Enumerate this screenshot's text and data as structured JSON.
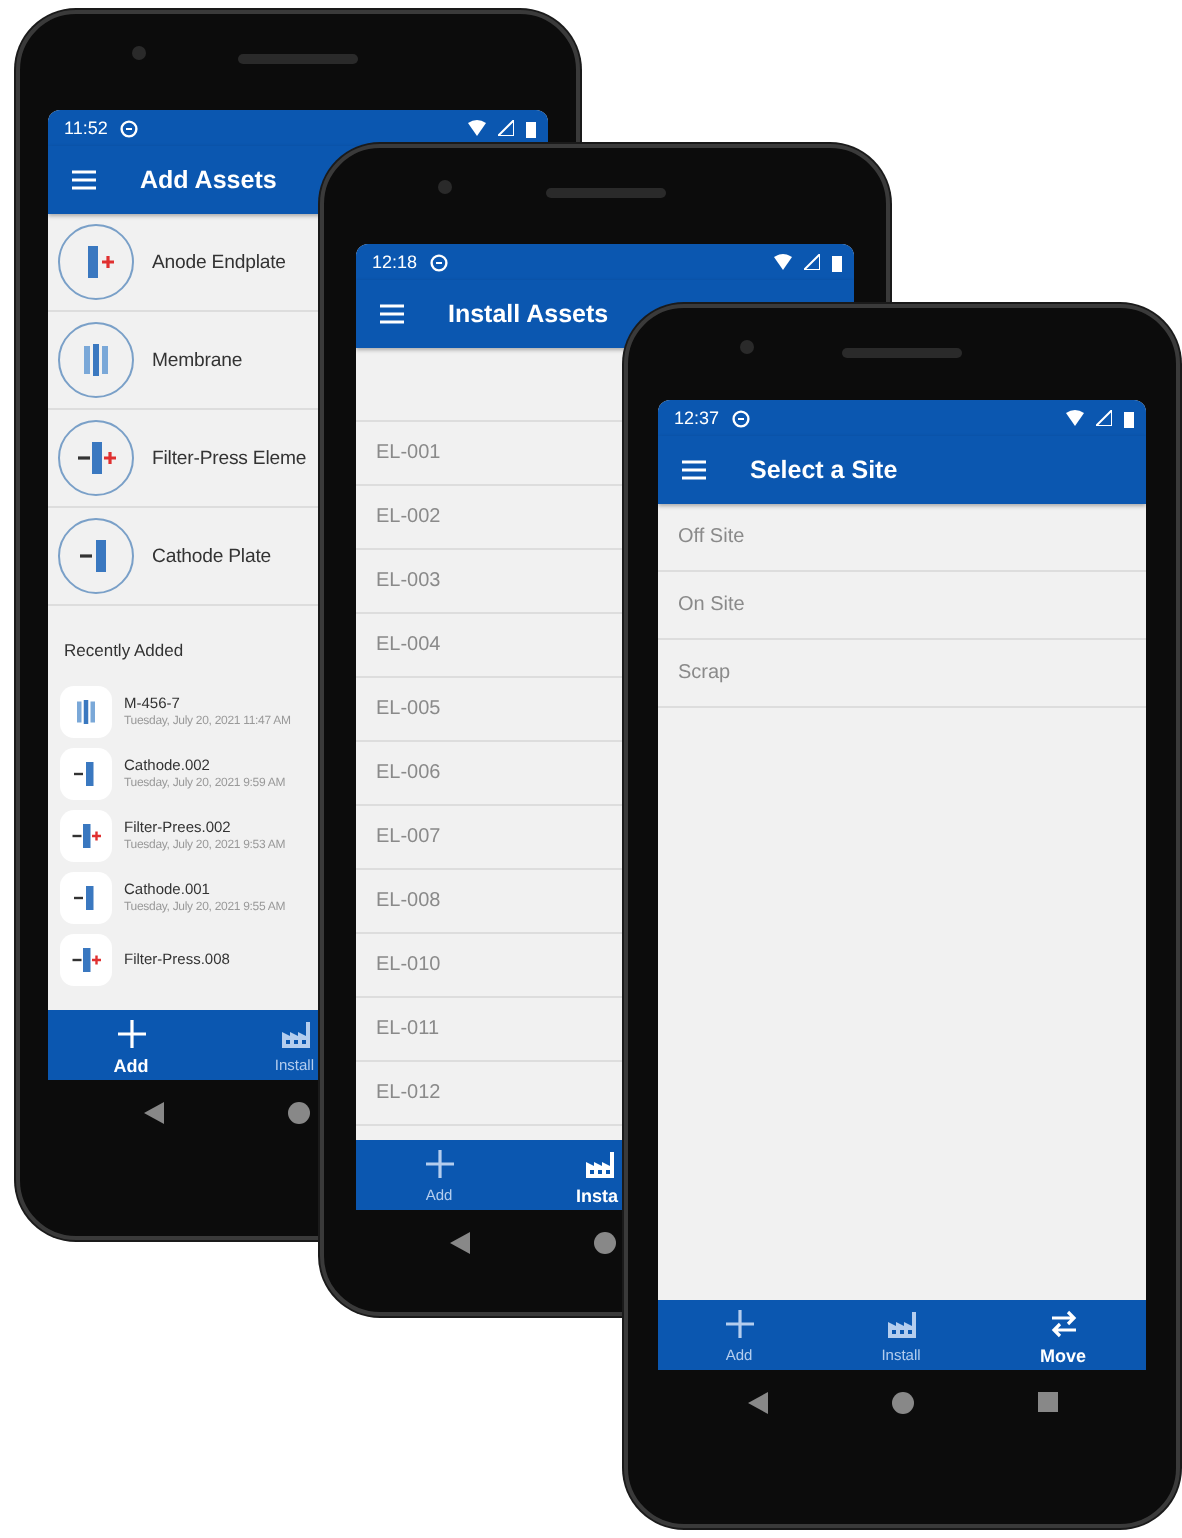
{
  "phones": [
    {
      "kind": "add",
      "status_bar": {
        "time": "11:52"
      },
      "app_bar": {
        "title": "Add Assets"
      },
      "asset_types": [
        {
          "label": "Anode Endplate",
          "kind": "anode"
        },
        {
          "label": "Membrane",
          "kind": "membrane"
        },
        {
          "label": "Filter-Press Eleme",
          "kind": "filter"
        },
        {
          "label": "Cathode Plate",
          "kind": "cathode"
        }
      ],
      "section_title": "Recently Added",
      "recent_items": [
        {
          "name": "M-456-7",
          "date": "Tuesday, July 20, 2021 11:47 AM",
          "kind": "membrane"
        },
        {
          "name": "Cathode.002",
          "date": "Tuesday, July 20, 2021 9:59 AM",
          "kind": "cathode"
        },
        {
          "name": "Filter-Prees.002",
          "date": "Tuesday, July 20, 2021 9:53 AM",
          "kind": "filter"
        },
        {
          "name": "Cathode.001",
          "date": "Tuesday, July 20, 2021 9:55 AM",
          "kind": "cathode"
        },
        {
          "name": "Filter-Press.008",
          "kind": "filter"
        }
      ],
      "bottom_nav": [
        {
          "label": "Add",
          "kind": "add",
          "selected": true
        },
        {
          "label": "Install",
          "kind": "install",
          "selected": false
        }
      ]
    },
    {
      "kind": "install",
      "status_bar": {
        "time": "12:18"
      },
      "app_bar": {
        "title": "Install Assets"
      },
      "list_items": [
        "EL-001",
        "EL-002",
        "EL-003",
        "EL-004",
        "EL-005",
        "EL-006",
        "EL-007",
        "EL-008",
        "EL-010",
        "EL-011",
        "EL-012"
      ],
      "bottom_nav": [
        {
          "label": "Add",
          "kind": "add",
          "selected": false
        },
        {
          "label": "Insta",
          "kind": "install",
          "selected": true
        }
      ]
    },
    {
      "kind": "site",
      "status_bar": {
        "time": "12:37"
      },
      "app_bar": {
        "title": "Select a Site"
      },
      "list_items": [
        "Off Site",
        "On Site",
        "Scrap"
      ],
      "bottom_nav": [
        {
          "label": "Add",
          "kind": "add",
          "selected": false
        },
        {
          "label": "Install",
          "kind": "install",
          "selected": false
        },
        {
          "label": "Move",
          "kind": "move",
          "selected": true
        }
      ]
    }
  ]
}
